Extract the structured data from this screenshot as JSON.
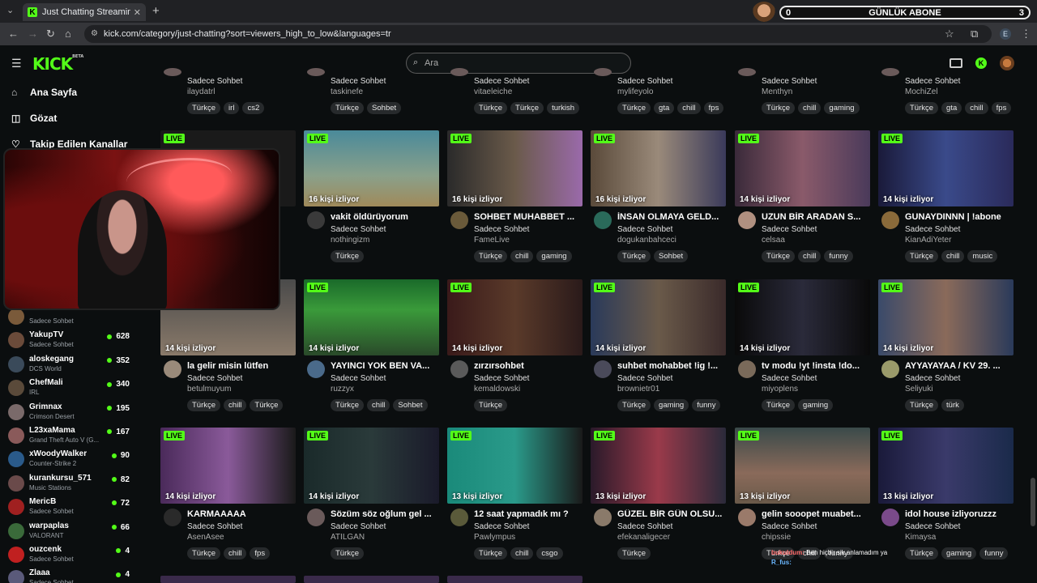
{
  "browser": {
    "tab_title": "Just Chatting Streaming - Live S",
    "tab_favicon": "K",
    "url": "kick.com/category/just-chatting?sort=viewers_high_to_low&languages=tr",
    "profile_letter": "E"
  },
  "widget": {
    "left_value": "0",
    "label": "GÜNLÜK ABONE",
    "right_value": "3"
  },
  "nav": {
    "logo": "KICK",
    "logo_badge": "BETA",
    "search_placeholder": "Ara"
  },
  "sidebar": {
    "main_items": [
      {
        "label": "Ana Sayfa",
        "icon": "home-icon"
      },
      {
        "label": "Gözat",
        "icon": "compass-icon"
      },
      {
        "label": "Takip Edilen Kanallar",
        "icon": "heart-icon"
      }
    ],
    "channels": [
      {
        "name": "",
        "game": "Sadece Sohbet",
        "viewers": "",
        "color": "#7a5a3a"
      },
      {
        "name": "YakupTV",
        "game": "Sadece Sohbet",
        "viewers": "628",
        "color": "#6b4b3a"
      },
      {
        "name": "aloskegang",
        "game": "DCS World",
        "viewers": "352",
        "color": "#3a4a5a"
      },
      {
        "name": "ChefMali",
        "game": "IRL",
        "viewers": "340",
        "color": "#5a4a3a"
      },
      {
        "name": "Grimnax",
        "game": "Crimson Desert",
        "viewers": "195",
        "color": "#7a6a6a"
      },
      {
        "name": "L23xaMama",
        "game": "Grand Theft Auto V (G...",
        "viewers": "167",
        "color": "#8a5a5a"
      },
      {
        "name": "xWoodyWalker",
        "game": "Counter-Strike 2",
        "viewers": "90",
        "color": "#2a5a8a"
      },
      {
        "name": "kurankursu_571",
        "game": "Music Stations",
        "viewers": "82",
        "color": "#6a4a4a"
      },
      {
        "name": "MericB",
        "game": "Sadece Sohbet",
        "viewers": "72",
        "color": "#a02020"
      },
      {
        "name": "warpaplas",
        "game": "VALORANT",
        "viewers": "66",
        "color": "#3a6a3a"
      },
      {
        "name": "ouzcenk",
        "game": "Sadece Sohbet",
        "viewers": "4",
        "color": "#c02020"
      },
      {
        "name": "Zlaaa",
        "game": "Sadece Sohbet",
        "viewers": "4",
        "color": "#5a5a7a"
      }
    ]
  },
  "live_label": "LIVE",
  "streams_top": [
    {
      "category": "Sadece Sohbet",
      "user": "ilaydatrl",
      "tags": [
        "Türkçe",
        "irl",
        "cs2"
      ]
    },
    {
      "category": "Sadece Sohbet",
      "user": "taskinefe",
      "tags": [
        "Türkçe",
        "Sohbet"
      ]
    },
    {
      "category": "Sadece Sohbet",
      "user": "vitaeleiche",
      "tags": [
        "Türkçe",
        "Türkçe",
        "turkish"
      ]
    },
    {
      "category": "Sadece Sohbet",
      "user": "mylifeyolo",
      "tags": [
        "Türkçe",
        "gta",
        "chill",
        "fps"
      ]
    },
    {
      "category": "Sadece Sohbet",
      "user": "Menthyn",
      "tags": [
        "Türkçe",
        "chill",
        "gaming"
      ]
    },
    {
      "category": "Sadece Sohbet",
      "user": "MochiZel",
      "tags": [
        "Türkçe",
        "gta",
        "chill",
        "fps"
      ]
    }
  ],
  "streams": [
    {
      "viewers": "",
      "title": "",
      "category": "",
      "user": "",
      "tags": [],
      "thumb": "#1a1a1a",
      "avatar": "#555"
    },
    {
      "viewers": "16 kişi izliyor",
      "title": "vakit öldürüyorum",
      "category": "Sadece Sohbet",
      "user": "nothingizm",
      "tags": [
        "Türkçe"
      ],
      "thumb": "linear-gradient(180deg,#4a8a9a,#8aa08a 60%,#a08a5a)",
      "avatar": "#3a3a3a"
    },
    {
      "viewers": "16 kişi izliyor",
      "title": "SOHBET MUHABBET ...",
      "category": "Sadece Sohbet",
      "user": "FameLive",
      "tags": [
        "Türkçe",
        "chill",
        "gaming"
      ],
      "thumb": "linear-gradient(90deg,#2a2a2a,#6a5a4a 50%,#9a6aaa)",
      "avatar": "#6a5a3a"
    },
    {
      "viewers": "16 kişi izliyor",
      "title": "İNSAN OLMAYA GELD...",
      "category": "Sadece Sohbet",
      "user": "dogukanbahceci",
      "tags": [
        "Türkçe",
        "Sohbet"
      ],
      "thumb": "linear-gradient(90deg,#5a4a3a,#9a8a7a 50%,#3a3a5a)",
      "avatar": "#2a6a5a"
    },
    {
      "viewers": "14 kişi izliyor",
      "title": "UZUN BİR ARADAN S...",
      "category": "Sadece Sohbet",
      "user": "celsaa",
      "tags": [
        "Türkçe",
        "chill",
        "funny"
      ],
      "thumb": "linear-gradient(90deg,#3a2a3a,#8a5a6a 50%,#4a3a5a)",
      "avatar": "#b09080"
    },
    {
      "viewers": "14 kişi izliyor",
      "title": "GUNAYDINNN | !abone",
      "category": "Sadece Sohbet",
      "user": "KianAdiYeter",
      "tags": [
        "Türkçe",
        "chill",
        "music"
      ],
      "thumb": "linear-gradient(90deg,#1a1a3a,#3a4a8a 50%,#2a2a5a)",
      "avatar": "#8a6a3a"
    },
    {
      "viewers": "14 kişi izliyor",
      "title": "la gelir misin lütfen",
      "category": "Sadece Sohbet",
      "user": "betulmuyum",
      "tags": [
        "Türkçe",
        "chill",
        "Türkçe"
      ],
      "thumb": "linear-gradient(180deg,#4a4a4a,#8a7a6a)",
      "avatar": "#9a8a7a"
    },
    {
      "viewers": "14 kişi izliyor",
      "title": "YAYINCI YOK BEN VA...",
      "category": "Sadece Sohbet",
      "user": "ruzzyx",
      "tags": [
        "Türkçe",
        "chill",
        "Sohbet"
      ],
      "thumb": "linear-gradient(180deg,#1a6a2a,#3a9a3a 40%,#2a4a2a)",
      "avatar": "#4a6a8a"
    },
    {
      "viewers": "14 kişi izliyor",
      "title": "zırzırsohbet",
      "category": "Sadece Sohbet",
      "user": "kemaldowski",
      "tags": [
        "Türkçe"
      ],
      "thumb": "linear-gradient(90deg,#3a1a1a,#5a3a2a 50%,#2a1a1a)",
      "avatar": "#5a5a5a"
    },
    {
      "viewers": "14 kişi izliyor",
      "title": "suhbet mohabbet !ig !...",
      "category": "Sadece Sohbet",
      "user": "brownietr01",
      "tags": [
        "Türkçe",
        "gaming",
        "funny"
      ],
      "thumb": "linear-gradient(90deg,#2a3a5a,#6a5a4a 50%,#3a2a2a)",
      "avatar": "#4a4a5a"
    },
    {
      "viewers": "14 kişi izliyor",
      "title": "tv modu !yt !insta !do...",
      "category": "Sadece Sohbet",
      "user": "miyoplens",
      "tags": [
        "Türkçe",
        "gaming"
      ],
      "thumb": "linear-gradient(90deg,#0a0a0a,#2a2a3a 50%,#0a0a0a)",
      "avatar": "#7a6a5a"
    },
    {
      "viewers": "14 kişi izliyor",
      "title": "AYYAYAYAA / KV 29. ...",
      "category": "Sadece Sohbet",
      "user": "Seliyuki",
      "tags": [
        "Türkçe",
        "türk"
      ],
      "thumb": "linear-gradient(90deg,#3a4a6a,#8a6a5a 50%,#2a3a5a)",
      "avatar": "#9a9a6a"
    },
    {
      "viewers": "14 kişi izliyor",
      "title": "KARMAAAAA",
      "category": "Sadece Sohbet",
      "user": "AsenAsee",
      "tags": [
        "Türkçe",
        "chill",
        "fps"
      ],
      "thumb": "linear-gradient(90deg,#4a2a5a,#8a5a9a 50%,#1a1a1a)",
      "avatar": "#2a2a2a"
    },
    {
      "viewers": "14 kişi izliyor",
      "title": "Sözüm söz oğlum gel ...",
      "category": "Sadece Sohbet",
      "user": "ATILGAN",
      "tags": [
        "Türkçe"
      ],
      "thumb": "linear-gradient(90deg,#1a2a2a,#2a3a3a 50%,#1a1a2a)",
      "avatar": "#6a5a5a"
    },
    {
      "viewers": "13 kişi izliyor",
      "title": "12 saat yapmadık mı ?",
      "category": "Sadece Sohbet",
      "user": "Pawlympus",
      "tags": [
        "Türkçe",
        "chill",
        "csgo"
      ],
      "thumb": "linear-gradient(90deg,#1a8a7a,#2a9a8a 50%,#1a1a1a)",
      "avatar": "#5a5a3a"
    },
    {
      "viewers": "13 kişi izliyor",
      "title": "GÜZEL BİR GÜN OLSU...",
      "category": "Sadece Sohbet",
      "user": "efekanaligecer",
      "tags": [
        "Türkçe"
      ],
      "thumb": "linear-gradient(90deg,#2a1a2a,#9a3a4a 50%,#2a2a3a)",
      "avatar": "#8a7a6a"
    },
    {
      "viewers": "13 kişi izliyor",
      "title": "gelin sooopet muabet...",
      "category": "Sadece Sohbet",
      "user": "chipssie",
      "tags": [
        "Türkçe",
        "chill",
        "funny"
      ],
      "thumb": "linear-gradient(180deg,#3a4a4a,#8a6a5a 60%,#6a5a4a)",
      "avatar": "#9a7a6a"
    },
    {
      "viewers": "13 kişi izliyor",
      "title": "idol house izliyoruzzz",
      "category": "Sadece Sohbet",
      "user": "Kimaysa",
      "tags": [
        "Türkçe",
        "gaming",
        "funny"
      ],
      "thumb": "linear-gradient(90deg,#1a1a3a,#3a3a6a 50%,#1a2a4a)",
      "avatar": "#7a4a8a"
    }
  ],
  "chat": [
    {
      "user": "bukuldum:",
      "msg": "Ben hiçbir sik anlamadım ya"
    },
    {
      "user": "R_fus:",
      "msg": ""
    }
  ]
}
